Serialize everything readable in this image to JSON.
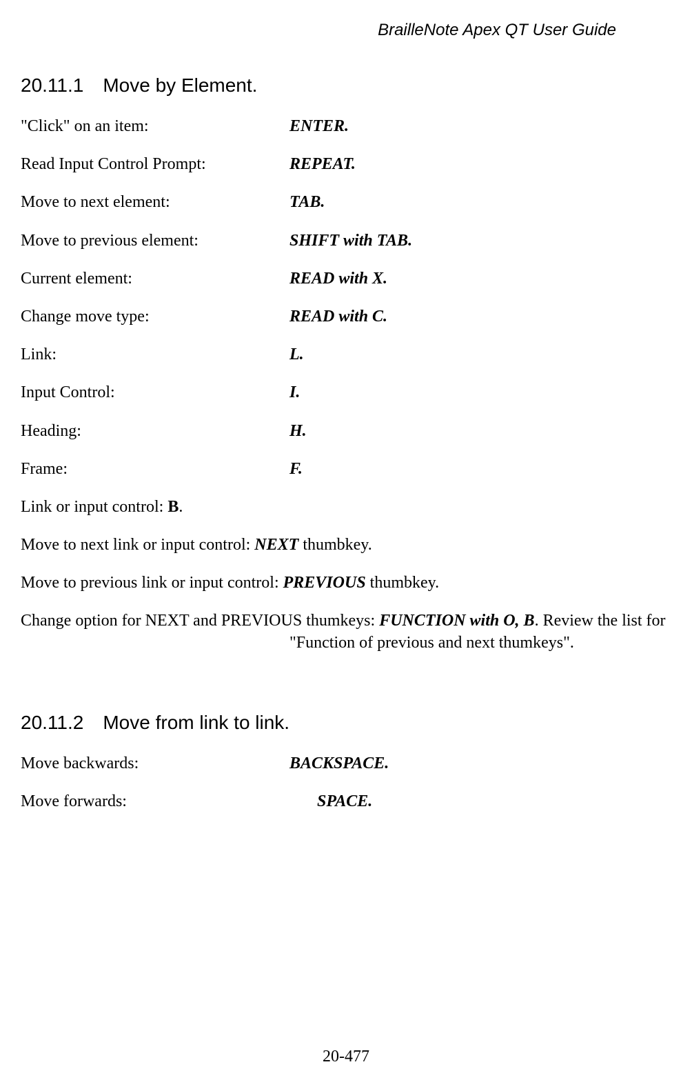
{
  "header": "BrailleNote Apex QT User Guide",
  "section1": {
    "number": "20.11.1",
    "title": "Move by Element."
  },
  "rows1": [
    {
      "label": "\"Click\" on an item:",
      "value": "ENTER."
    },
    {
      "label": "Read Input Control Prompt:",
      "value": "REPEAT."
    },
    {
      "label": "Move to next element:",
      "value": "TAB."
    },
    {
      "label": "Move to previous element:",
      "value": "SHIFT with TAB."
    },
    {
      "label": "Current element:",
      "value": "READ with X."
    },
    {
      "label": "Change move type:",
      "value": "READ with C."
    },
    {
      "label": "Link:",
      "value": "L."
    },
    {
      "label": "Input Control:",
      "value": "I."
    },
    {
      "label": "Heading:",
      "value": "H."
    },
    {
      "label": "Frame:",
      "value": "F."
    }
  ],
  "para1": {
    "pre": "Link or input control: ",
    "bold": "B",
    "post": "."
  },
  "para2": {
    "pre": "Move to next link or input control: ",
    "bold": "NEXT",
    "post": " thumbkey."
  },
  "para3": {
    "pre": "Move to previous link or input control: ",
    "bold": "PREVIOUS",
    "post": " thumbkey."
  },
  "para4": {
    "pre": "Change option for NEXT and PREVIOUS thumkeys: ",
    "bold": "FUNCTION with O, B",
    "post1": ". Review the list for ",
    "post2": "\"Function of previous and next thumkeys\"."
  },
  "section2": {
    "number": "20.11.2",
    "title": "Move from link to link."
  },
  "rows2": [
    {
      "label": "Move backwards:",
      "value": "BACKSPACE."
    },
    {
      "label": "Move forwards:",
      "value": "SPACE."
    }
  ],
  "footer": "20-477"
}
